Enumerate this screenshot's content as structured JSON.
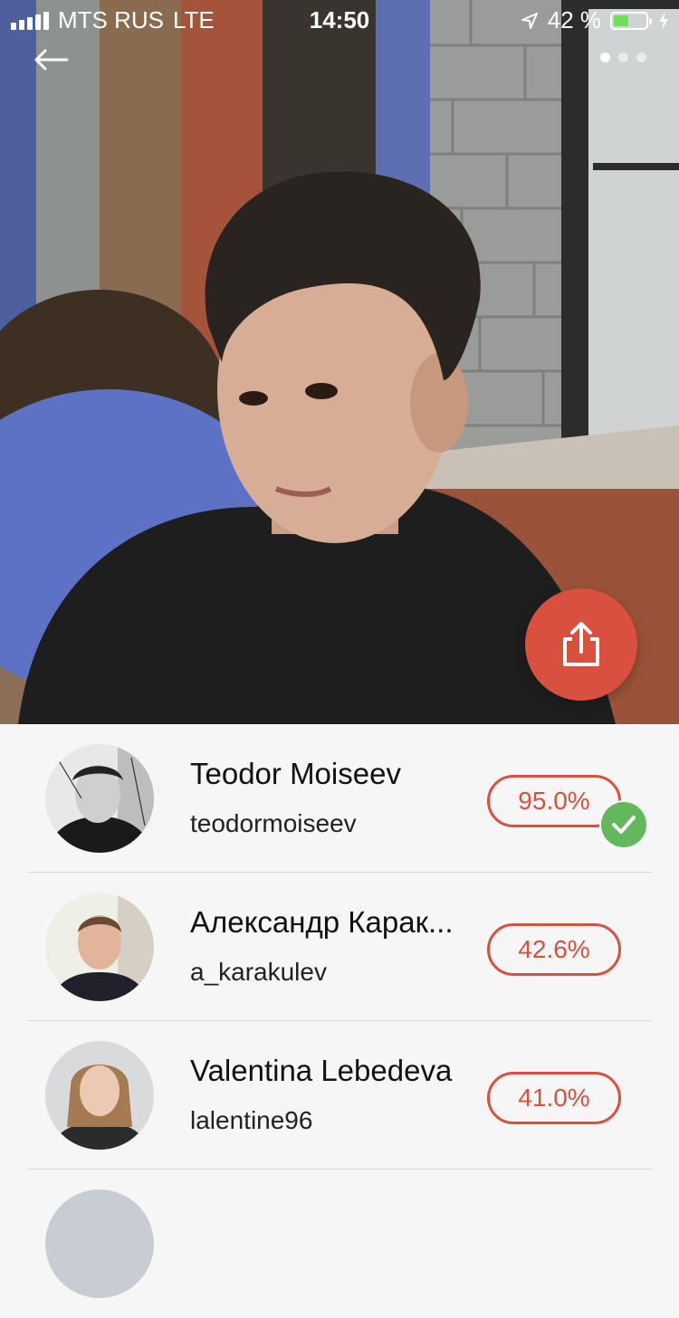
{
  "status_bar": {
    "carrier": "MTS RUS",
    "network": "LTE",
    "time": "14:50",
    "battery_percent": "42 %",
    "battery_level": 0.42
  },
  "nav": {
    "back_icon": "arrow-left-icon",
    "page_count": 3,
    "active_page": 1
  },
  "share_button": {
    "icon": "share-icon"
  },
  "colors": {
    "accent": "#d9503f",
    "success": "#62b85a"
  },
  "matches": [
    {
      "name": "Teodor Moiseev",
      "username": "teodormoiseev",
      "score": "95.0%",
      "verified": true
    },
    {
      "name": "Александр Карак...",
      "username": "a_karakulev",
      "score": "42.6%",
      "verified": false
    },
    {
      "name": "Valentina Lebedeva",
      "username": "lalentine96",
      "score": "41.0%",
      "verified": false
    },
    {
      "name": "",
      "username": "",
      "score": "",
      "verified": false
    }
  ]
}
